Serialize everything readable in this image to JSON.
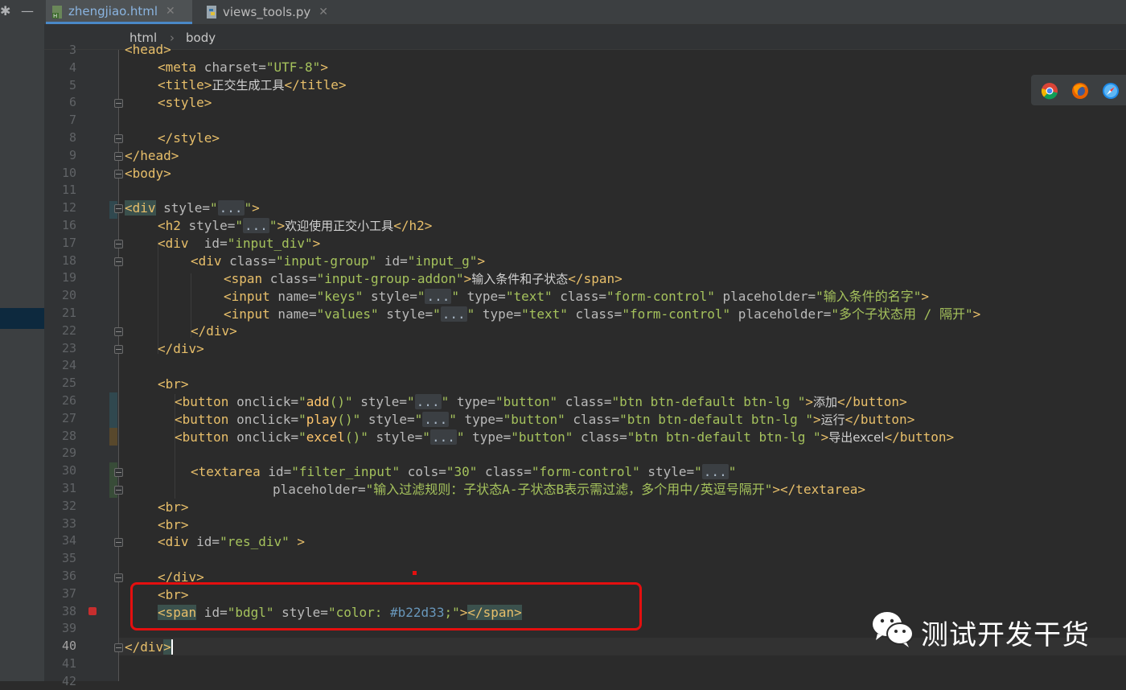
{
  "tabs": [
    {
      "label": "zhengjiao.html",
      "active": true,
      "icon": "html-file-icon"
    },
    {
      "label": "views_tools.py",
      "active": false,
      "icon": "python-file-icon"
    }
  ],
  "breadcrumb": [
    "html",
    "body"
  ],
  "line_numbers": [
    "3",
    "4",
    "5",
    "6",
    "7",
    "8",
    "9",
    "10",
    "11",
    "12",
    "16",
    "17",
    "18",
    "19",
    "20",
    "21",
    "22",
    "23",
    "24",
    "25",
    "26",
    "27",
    "28",
    "29",
    "30",
    "31",
    "32",
    "33",
    "34",
    "35",
    "36",
    "37",
    "38",
    "39",
    "40",
    "41",
    "42"
  ],
  "current_line": "40",
  "code": {
    "l4": {
      "tag_open": "<meta",
      "attr": " charset=",
      "val": "\"UTF-8\"",
      "end": ">"
    },
    "l5": {
      "open": "<title>",
      "text": "正交生成工具",
      "close": "</title>"
    },
    "l6": "<style>",
    "l8": "</style>",
    "l9": "</head>",
    "l10": "<body>",
    "l12": {
      "open": "<div",
      "attr": " style=",
      "q1": "\"",
      "fold": "...",
      "q2": "\"",
      "end": ">"
    },
    "l16": {
      "open": "<h2",
      "attr": " style=",
      "q1": "\"",
      "fold": "...",
      "q2": "\"",
      "end": ">",
      "text": "欢迎使用正交小工具",
      "close": "</h2>"
    },
    "l17": {
      "open": "<div",
      "attr": "  id=",
      "val": "\"input_div\"",
      "end": ">"
    },
    "l18": {
      "open": "<div",
      "attr1": " class=",
      "val1": "\"input-group\"",
      "attr2": " id=",
      "val2": "\"input_g\"",
      "end": ">"
    },
    "l19": {
      "open": "<span",
      "attr": " class=",
      "val": "\"input-group-addon\"",
      "end": ">",
      "text": "输入条件和子状态",
      "close": "</span>"
    },
    "l20": {
      "open": "<input",
      "attr1": " name=",
      "val1": "\"keys\"",
      "attr2": " style=",
      "q1": "\"",
      "fold": "...",
      "q2": "\"",
      "attr3": " type=",
      "val3": "\"text\"",
      "attr4": " class=",
      "val4": "\"form-control\"",
      "attr5": " placeholder=",
      "val5": "\"输入条件的名字\"",
      "end": ">"
    },
    "l21": {
      "open": "<input",
      "attr1": " name=",
      "val1": "\"values\"",
      "attr2": " style=",
      "q1": "\"",
      "fold": "...",
      "q2": "\"",
      "attr3": " type=",
      "val3": "\"text\"",
      "attr4": " class=",
      "val4": "\"form-control\"",
      "attr5": " placeholder=",
      "val5": "\"多个子状态用 / 隔开\"",
      "end": ">"
    },
    "l22": "</div>",
    "l23": "</div>",
    "l25": "<br>",
    "l26": {
      "open": "<button",
      "attr1": " onclick=",
      "q0": "\"",
      "fn": "add",
      "fnend": "()\"",
      "attr2": " style=",
      "q1": "\"",
      "fold": "...",
      "q2": "\"",
      "attr3": " type=",
      "val3": "\"button\"",
      "attr4": " class=",
      "val4": "\"btn btn-default btn-lg \"",
      "end": ">",
      "text": "添加",
      "close": "</button>"
    },
    "l27": {
      "open": "<button",
      "attr1": " onclick=",
      "q0": "\"",
      "fn": "play",
      "fnend": "()\"",
      "attr2": " style=",
      "q1": "\"",
      "fold": "...",
      "q2": "\"",
      "attr3": " type=",
      "val3": "\"button\"",
      "attr4": " class=",
      "val4": "\"btn btn-default btn-lg \"",
      "end": ">",
      "text": "运行",
      "close": "</button>"
    },
    "l28": {
      "open": "<button",
      "attr1": " onclick=",
      "q0": "\"",
      "fn": "excel",
      "fnend": "()\"",
      "attr2": " style=",
      "q1": "\"",
      "fold": "...",
      "q2": "\"",
      "attr3": " type=",
      "val3": "\"button\"",
      "attr4": " class=",
      "val4": "\"btn btn-default btn-lg \"",
      "end": ">",
      "text": "导出excel",
      "close": "</button>"
    },
    "l30": {
      "open": "<textarea",
      "attr1": " id=",
      "val1": "\"filter_input\"",
      "attr2": " cols=",
      "val2": "\"30\"",
      "attr3": " class=",
      "val3": "\"form-control\"",
      "attr4": " style=",
      "q1": "\"",
      "fold": "...",
      "q2": "\""
    },
    "l31": {
      "attr": "placeholder=",
      "val": "\"输入过滤规则：子状态A-子状态B表示需过滤，多个用中/英逗号隔开\"",
      "end": "></textarea>"
    },
    "l32": "<br>",
    "l33": "<br>",
    "l34": {
      "open": "<div",
      "attr": " id=",
      "val": "\"res_div\"",
      "end": " >"
    },
    "l36": "</div>",
    "l37": "<br>",
    "l38": {
      "open": "<span",
      "attr1": " id=",
      "val1": "\"bdgl\"",
      "attr2": " style=",
      "q1": "\"",
      "css": "color: ",
      "color": "#b22d33",
      "q2": ";\"",
      "end": ">",
      "close": "</span>"
    },
    "l40": {
      "close": "</div",
      "end": ">"
    }
  },
  "browser_icons": [
    "chrome-icon",
    "firefox-icon",
    "safari-icon"
  ],
  "watermark": {
    "text": "测试开发干货",
    "icon": "wechat-icon"
  },
  "colors": {
    "tag": "#e8bf6a",
    "value": "#a5c25c",
    "annotation_red": "#e40f0f",
    "span_color": "#b22d33"
  }
}
